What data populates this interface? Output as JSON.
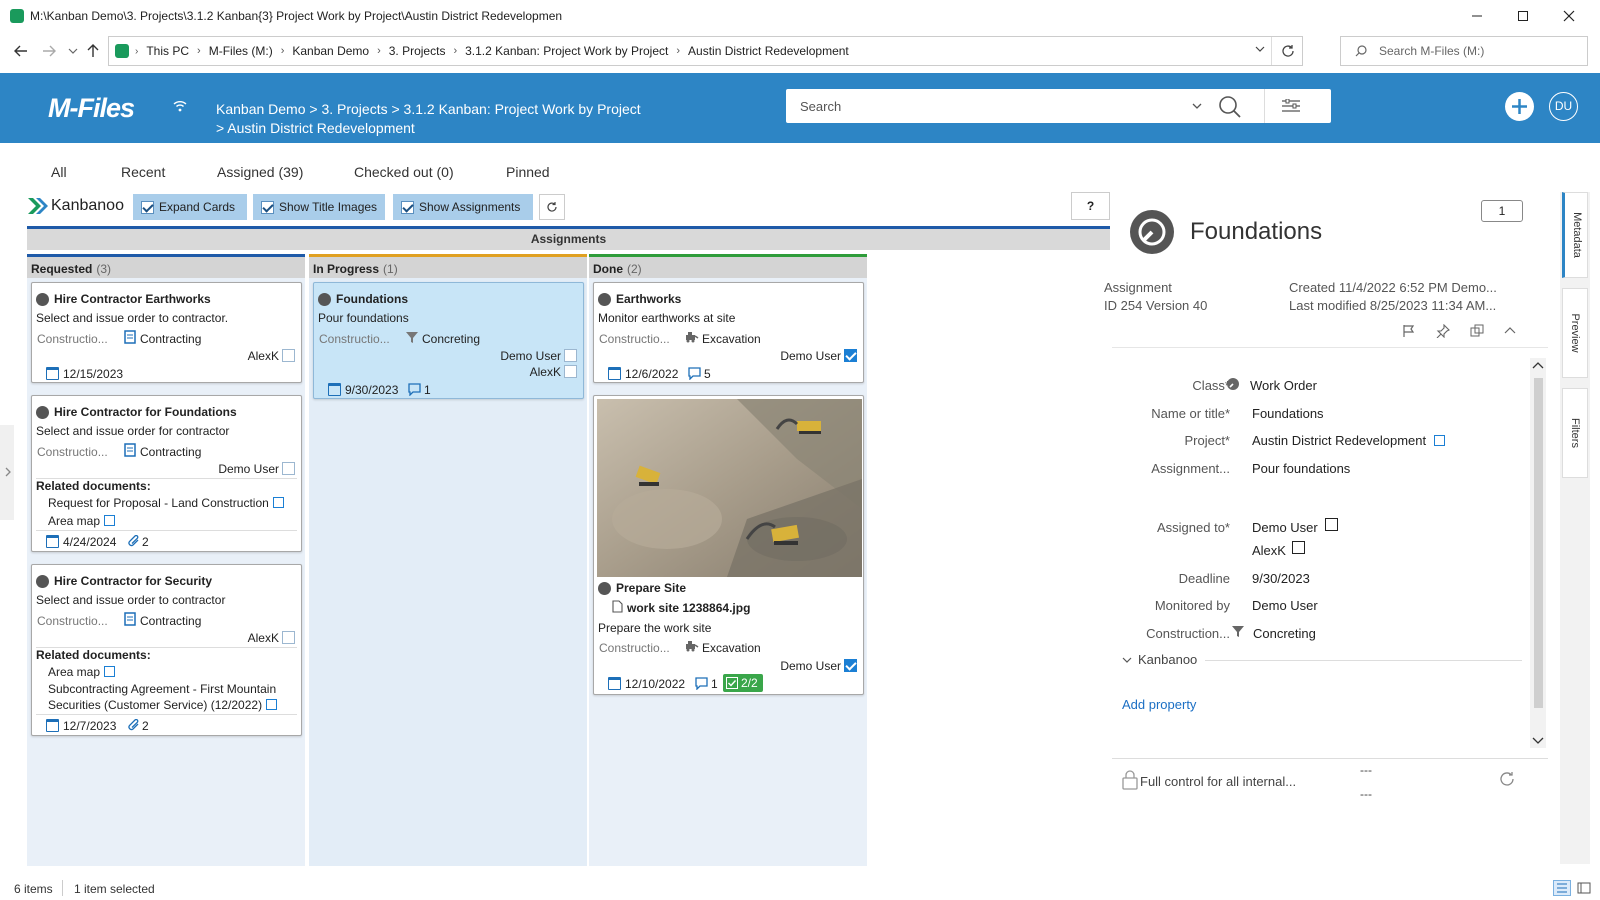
{
  "window": {
    "title": "M:\\Kanban Demo\\3. Projects\\3.1.2 Kanban{3} Project Work by Project\\Austin District Redevelopmen"
  },
  "address": {
    "crumbs": [
      "This PC",
      "M-Files (M:)",
      "Kanban Demo",
      "3. Projects",
      "3.1.2 Kanban: Project Work by Project",
      "Austin District Redevelopment"
    ],
    "search_placeholder": "Search M-Files (M:)"
  },
  "header": {
    "logo": "M-Files",
    "breadcrumb_line1": "Kanban Demo > 3. Projects > 3.1.2 Kanban: Project Work by Project",
    "breadcrumb_line2": "> Austin District Redevelopment",
    "search_placeholder": "Search",
    "user_initials": "DU",
    "brand_color": "#2d85c5"
  },
  "tabs": [
    "All",
    "Recent",
    "Assigned (39)",
    "Checked out (0)",
    "Pinned"
  ],
  "kanban_toolbar": {
    "brand": "Kanbanoo",
    "expand_cards": "Expand Cards",
    "show_title_images": "Show Title Images",
    "show_assignments": "Show Assignments",
    "help": "?"
  },
  "board": {
    "title": "Assignments",
    "columns": [
      {
        "name": "Requested",
        "count": "(3)",
        "color": "#1e5aa8"
      },
      {
        "name": "In Progress",
        "count": "(1)",
        "color": "#e0a020"
      },
      {
        "name": "Done",
        "count": "(2)",
        "color": "#2e9c3a"
      }
    ],
    "cards": {
      "c1": {
        "title": "Hire Contractor Earthworks",
        "desc": "Select and issue order to contractor.",
        "cat": "Constructio...",
        "sub": "Contracting",
        "user": "AlexK",
        "date": "12/15/2023"
      },
      "c2": {
        "title": "Hire Contractor for Foundations",
        "desc": "Select and issue order for contractor",
        "cat": "Constructio...",
        "sub": "Contracting",
        "user": "Demo User",
        "related_label": "Related documents:",
        "rel1": "Request for Proposal - Land Construction",
        "rel2": "Area map",
        "date": "4/24/2024",
        "attach": "2"
      },
      "c3": {
        "title": "Hire Contractor for Security",
        "desc": "Select and issue order to contractor",
        "cat": "Constructio...",
        "sub": "Contracting",
        "user": "AlexK",
        "related_label": "Related documents:",
        "rel1": "Area map",
        "rel2a": "Subcontracting Agreement - First Mountain",
        "rel2b": "Securities (Customer Service) (12/2022)",
        "date": "12/7/2023",
        "attach": "2"
      },
      "c4": {
        "title": "Foundations",
        "desc": "Pour foundations",
        "cat": "Constructio...",
        "sub": "Concreting",
        "user1": "Demo User",
        "user2": "AlexK",
        "date": "9/30/2023",
        "comments": "1"
      },
      "c5": {
        "title": "Earthworks",
        "desc": "Monitor earthworks at site",
        "cat": "Constructio...",
        "sub": "Excavation",
        "user": "Demo User",
        "date": "12/6/2022",
        "comments": "5"
      },
      "c6": {
        "title": "Prepare Site",
        "file": "work site 1238864.jpg",
        "desc": "Prepare the work site",
        "cat": "Constructio...",
        "sub": "Excavation",
        "user": "Demo User",
        "date": "12/10/2022",
        "comments": "1",
        "tasks": "2/2"
      }
    }
  },
  "panel": {
    "title": "Foundations",
    "comments_count": "1",
    "type": "Assignment",
    "id_version": "ID 254  Version 40",
    "created": "Created 11/4/2022 6:52 PM Demo...",
    "modified": "Last modified 8/25/2023 11:34 AM...",
    "props": [
      {
        "label": "Class*",
        "value": "Work Order"
      },
      {
        "label": "Name or title*",
        "value": "Foundations"
      },
      {
        "label": "Project*",
        "value": "Austin District Redevelopment"
      },
      {
        "label": "Assignment...",
        "value": "Pour foundations"
      },
      {
        "label": "Assigned to*",
        "value": "Demo User"
      },
      {
        "label": "",
        "value": "AlexK"
      },
      {
        "label": "Deadline",
        "value": "9/30/2023"
      },
      {
        "label": "Monitored by",
        "value": "Demo User"
      },
      {
        "label": "Construction...",
        "value": "Concreting"
      }
    ],
    "group": "Kanbanoo",
    "add_property": "Add property",
    "permissions": "Full control for all internal...",
    "dash1": "---",
    "dash2": "---",
    "side_tabs": [
      "Metadata",
      "Preview",
      "Filters"
    ]
  },
  "status": {
    "items": "6 items",
    "selected": "1 item selected"
  }
}
